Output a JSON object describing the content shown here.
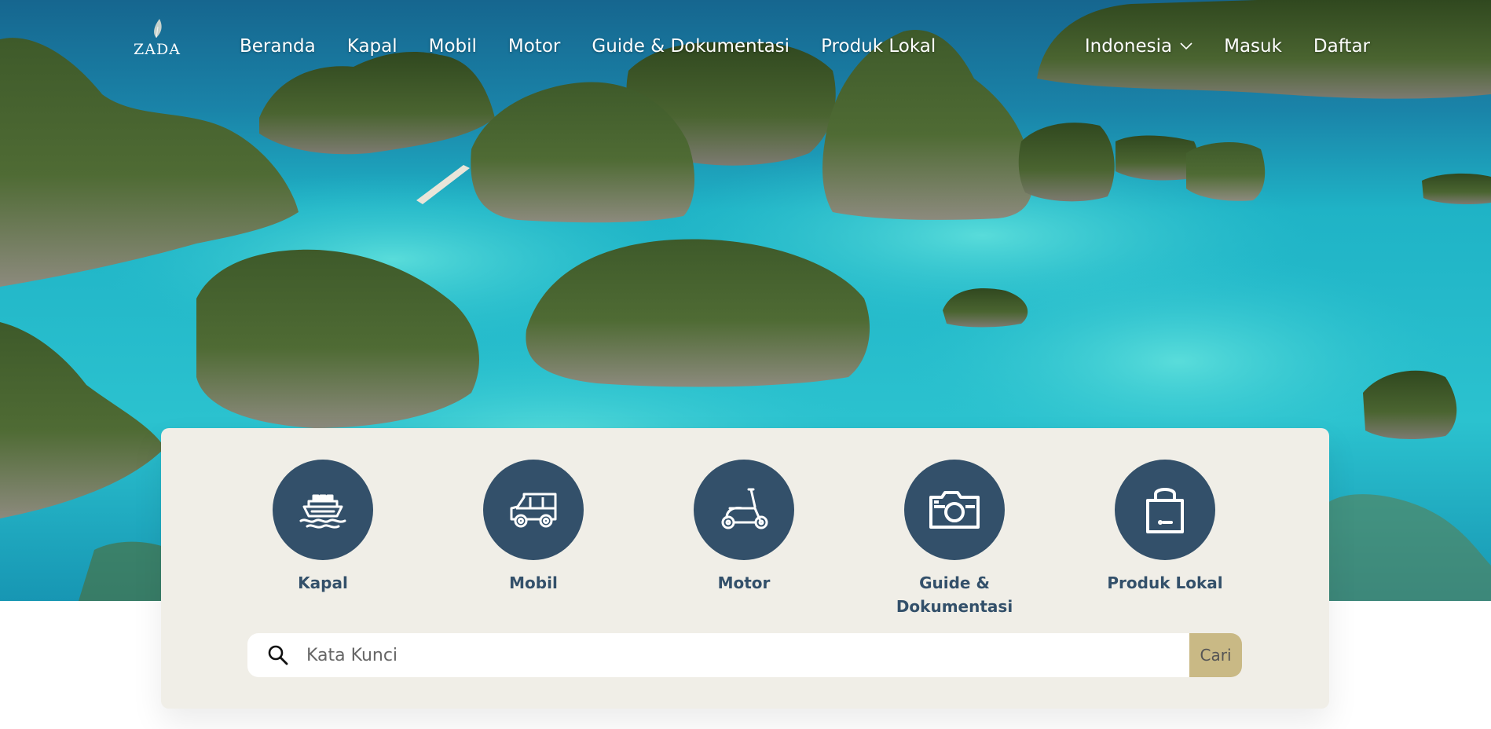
{
  "brand": {
    "logo_text": "ZADA"
  },
  "nav": {
    "links": [
      {
        "label": "Beranda"
      },
      {
        "label": "Kapal"
      },
      {
        "label": "Mobil"
      },
      {
        "label": "Motor"
      },
      {
        "label": "Guide & Dokumentasi"
      },
      {
        "label": "Produk Lokal"
      }
    ],
    "language": "Indonesia",
    "login": "Masuk",
    "register": "Daftar"
  },
  "categories": [
    {
      "label": "Kapal",
      "icon": "ship-icon"
    },
    {
      "label": "Mobil",
      "icon": "car-icon"
    },
    {
      "label": "Motor",
      "icon": "scooter-icon"
    },
    {
      "label": "Guide & Dokumentasi",
      "icon": "camera-icon"
    },
    {
      "label": "Produk Lokal",
      "icon": "shopping-bag-icon"
    }
  ],
  "search": {
    "placeholder": "Kata Kunci",
    "value": "",
    "button_label": "Cari"
  },
  "colors": {
    "accent": "#33506a",
    "panel_bg": "#f0eee7",
    "search_button": "#c9b985",
    "sea": "#1aa9c4"
  }
}
